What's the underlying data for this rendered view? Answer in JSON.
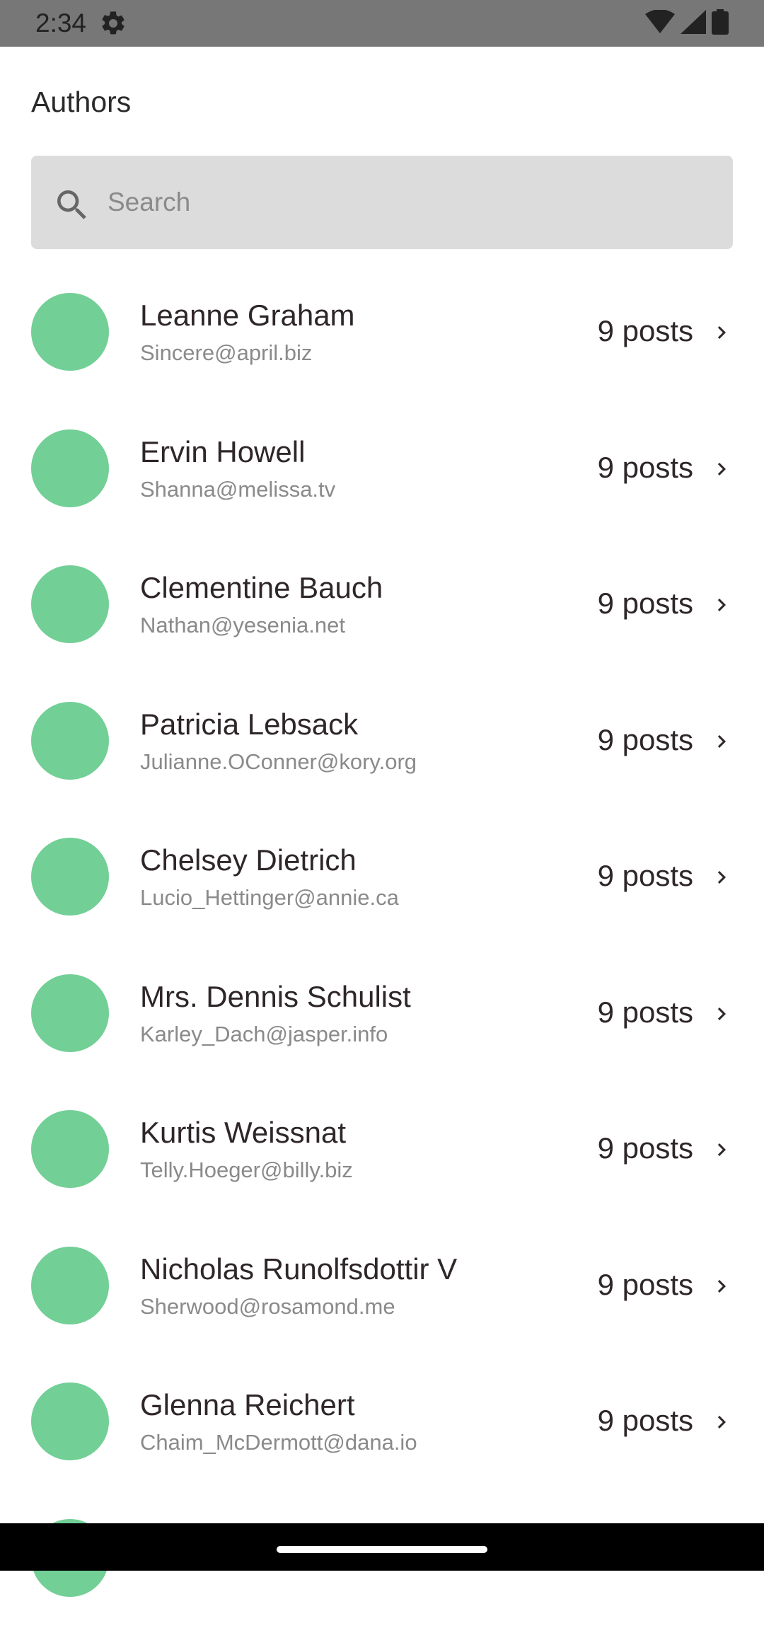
{
  "status_bar": {
    "time": "2:34",
    "icons": [
      "gear-icon",
      "wifi-icon",
      "signal-icon",
      "battery-icon"
    ]
  },
  "header": {
    "title": "Authors"
  },
  "search": {
    "placeholder": "Search",
    "value": ""
  },
  "colors": {
    "avatar": "#72cf96",
    "search_background": "#dcdcdc",
    "status_bar": "#777777"
  },
  "authors": [
    {
      "name": "Leanne Graham",
      "email": "Sincere@april.biz",
      "posts": "9 posts"
    },
    {
      "name": "Ervin Howell",
      "email": "Shanna@melissa.tv",
      "posts": "9 posts"
    },
    {
      "name": "Clementine Bauch",
      "email": "Nathan@yesenia.net",
      "posts": "9 posts"
    },
    {
      "name": "Patricia Lebsack",
      "email": "Julianne.OConner@kory.org",
      "posts": "9 posts"
    },
    {
      "name": "Chelsey Dietrich",
      "email": "Lucio_Hettinger@annie.ca",
      "posts": "9 posts"
    },
    {
      "name": "Mrs. Dennis Schulist",
      "email": "Karley_Dach@jasper.info",
      "posts": "9 posts"
    },
    {
      "name": "Kurtis Weissnat",
      "email": "Telly.Hoeger@billy.biz",
      "posts": "9 posts"
    },
    {
      "name": "Nicholas Runolfsdottir V",
      "email": "Sherwood@rosamond.me",
      "posts": "9 posts"
    },
    {
      "name": "Glenna Reichert",
      "email": "Chaim_McDermott@dana.io",
      "posts": "9 posts"
    },
    {
      "name": "",
      "email": "",
      "posts": ""
    }
  ]
}
